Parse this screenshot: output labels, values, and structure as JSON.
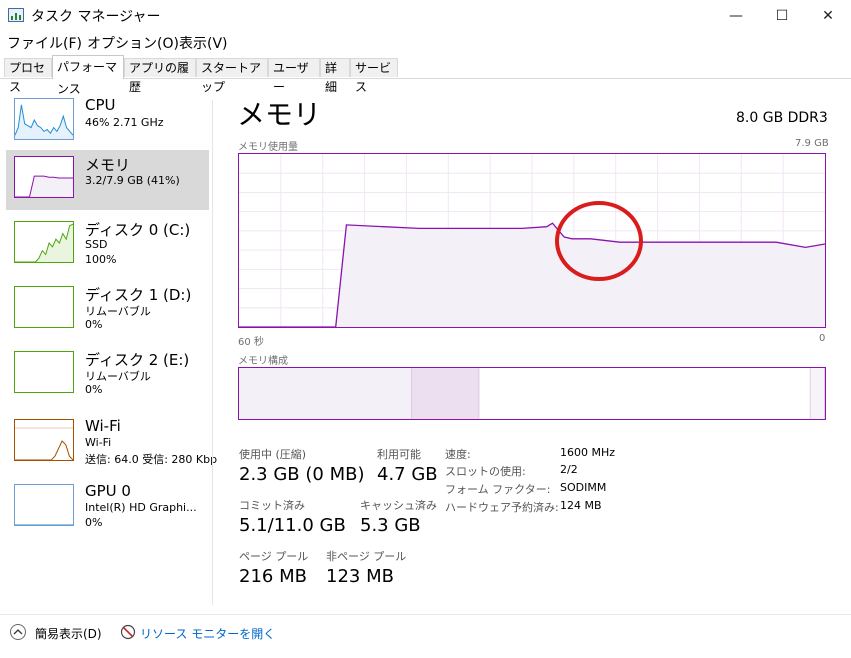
{
  "window": {
    "title": "タスク マネージャー",
    "min_glyph": "—",
    "max_glyph": "☐",
    "close_glyph": "✕"
  },
  "menu": [
    "ファイル(F)",
    "オプション(O)",
    "表示(V)"
  ],
  "tabs": [
    "プロセス",
    "パフォーマンス",
    "アプリの履歴",
    "スタートアップ",
    "ユーザー",
    "詳細",
    "サービス"
  ],
  "active_tab": "パフォーマンス",
  "sidebar": [
    {
      "title": "CPU",
      "sub1": "46%  2.71 GHz",
      "sub2": "",
      "sub3": ""
    },
    {
      "title": "メモリ",
      "sub1": "3.2/7.9 GB (41%)",
      "sub2": "",
      "sub3": ""
    },
    {
      "title": "ディスク 0 (C:)",
      "sub1": "SSD",
      "sub2": "100%",
      "sub3": ""
    },
    {
      "title": "ディスク 1 (D:)",
      "sub1": "リムーバブル",
      "sub2": "0%",
      "sub3": ""
    },
    {
      "title": "ディスク 2 (E:)",
      "sub1": "リムーバブル",
      "sub2": "0%",
      "sub3": ""
    },
    {
      "title": "Wi-Fi",
      "sub1": "Wi-Fi",
      "sub2": "送信: 64.0  受信: 280 Kbp",
      "sub3": ""
    },
    {
      "title": "GPU 0",
      "sub1": "Intel(R) HD Graphi...",
      "sub2": "0%",
      "sub3": ""
    }
  ],
  "main": {
    "title": "メモリ",
    "spec": "8.0 GB DDR3",
    "usage_label": "メモリ使用量",
    "max_label": "7.9 GB",
    "time_left": "60 秒",
    "time_right": "0",
    "composition_label": "メモリ構成"
  },
  "stats": {
    "in_use_label": "使用中 (圧縮)",
    "in_use_value": "2.3 GB (0 MB)",
    "available_label": "利用可能",
    "available_value": "4.7 GB",
    "committed_label": "コミット済み",
    "committed_value": "5.1/11.0 GB",
    "cached_label": "キャッシュ済み",
    "cached_value": "5.3 GB",
    "paged_label": "ページ プール",
    "paged_value": "216 MB",
    "nonpaged_label": "非ページ プール",
    "nonpaged_value": "123 MB"
  },
  "specs": [
    {
      "key": "速度:",
      "value": "1600 MHz"
    },
    {
      "key": "スロットの使用:",
      "value": "2/2"
    },
    {
      "key": "フォーム ファクター:",
      "value": "SODIMM"
    },
    {
      "key": "ハードウェア予約済み:",
      "value": "124 MB"
    }
  ],
  "footer": {
    "fewer_details": "簡易表示(D)",
    "resource_monitor": "リソース モニターを開く"
  },
  "colors": {
    "memory_line": "#8b12ae",
    "memory_fill": "#f4f0f7",
    "cpu_line": "#1f8fd6",
    "disk_line": "#4da60c",
    "wifi_line": "#a74f01",
    "gpu_line": "#1f8fd6",
    "link": "#0066cc",
    "annotation": "#d91c1c",
    "selected_bg": "#d9d9d9"
  },
  "memory_history": {
    "x_seconds": [
      60,
      50.1,
      49,
      41.6,
      35,
      31,
      28.5,
      27.9,
      26.7,
      25.9,
      24,
      21,
      12,
      5,
      2,
      0
    ],
    "used_fraction": [
      0,
      0,
      0.59,
      0.57,
      0.57,
      0.57,
      0.58,
      0.6,
      0.52,
      0.51,
      0.51,
      0.49,
      0.49,
      0.49,
      0.46,
      0.48
    ]
  },
  "composition": {
    "in_use_fraction": 0.295,
    "modified_fraction": 0.115,
    "standby_fraction": 0.565,
    "free_fraction": 0.025
  },
  "thumb_series": {
    "cpu": [
      0.1,
      0.3,
      0.9,
      0.4,
      0.35,
      0.3,
      0.5,
      0.35,
      0.3,
      0.2,
      0.25,
      0.15,
      0.3,
      0.2,
      0.35,
      0.6,
      0.3,
      0.2,
      0.1
    ],
    "memory": [
      0,
      0,
      0,
      0,
      0.55,
      0.55,
      0.55,
      0.52,
      0.52,
      0.5,
      0.5,
      0.5,
      0.5
    ],
    "disk": [
      0,
      0,
      0,
      0,
      0,
      0,
      0,
      0.1,
      0.3,
      0.2,
      0.5,
      0.4,
      0.6,
      0.5,
      0.75,
      0.6,
      0.95,
      1
    ],
    "wifi": [
      0,
      0,
      0,
      0,
      0,
      0,
      0,
      0,
      0,
      0,
      0,
      0.1,
      0.3,
      0.5,
      0.4,
      0.1,
      0
    ],
    "gpu": [
      0,
      0,
      0,
      0,
      0,
      0,
      0,
      0,
      0,
      0
    ]
  }
}
